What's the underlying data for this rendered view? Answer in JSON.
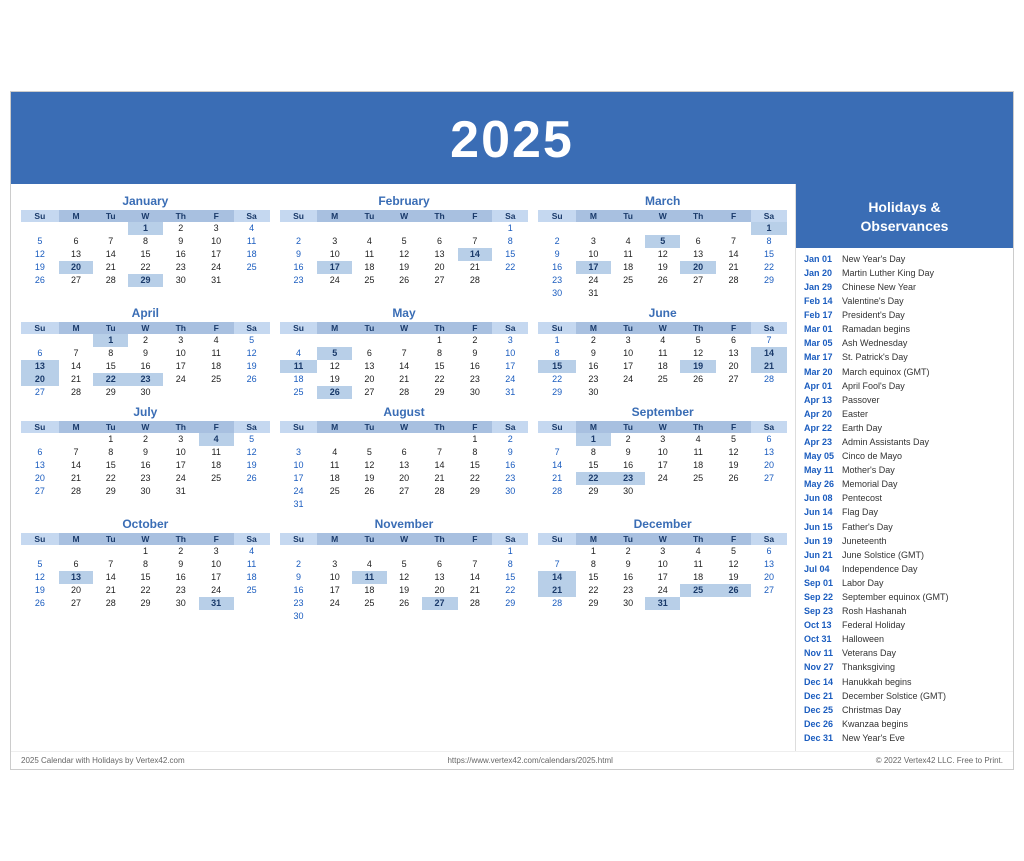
{
  "header": {
    "year": "2025"
  },
  "sidebar_title": "Holidays &\nObservances",
  "holidays": [
    {
      "date": "Jan 01",
      "name": "New Year's Day"
    },
    {
      "date": "Jan 20",
      "name": "Martin Luther King Day"
    },
    {
      "date": "Jan 29",
      "name": "Chinese New Year"
    },
    {
      "date": "Feb 14",
      "name": "Valentine's Day"
    },
    {
      "date": "Feb 17",
      "name": "President's Day"
    },
    {
      "date": "Mar 01",
      "name": "Ramadan begins"
    },
    {
      "date": "Mar 05",
      "name": "Ash Wednesday"
    },
    {
      "date": "Mar 17",
      "name": "St. Patrick's Day"
    },
    {
      "date": "Mar 20",
      "name": "March equinox (GMT)"
    },
    {
      "date": "Apr 01",
      "name": "April Fool's Day"
    },
    {
      "date": "Apr 13",
      "name": "Passover"
    },
    {
      "date": "Apr 20",
      "name": "Easter"
    },
    {
      "date": "Apr 22",
      "name": "Earth Day"
    },
    {
      "date": "Apr 23",
      "name": "Admin Assistants Day"
    },
    {
      "date": "May 05",
      "name": "Cinco de Mayo"
    },
    {
      "date": "May 11",
      "name": "Mother's Day"
    },
    {
      "date": "May 26",
      "name": "Memorial Day"
    },
    {
      "date": "Jun 08",
      "name": "Pentecost"
    },
    {
      "date": "Jun 14",
      "name": "Flag Day"
    },
    {
      "date": "Jun 15",
      "name": "Father's Day"
    },
    {
      "date": "Jun 19",
      "name": "Juneteenth"
    },
    {
      "date": "Jun 21",
      "name": "June Solstice (GMT)"
    },
    {
      "date": "Jul 04",
      "name": "Independence Day"
    },
    {
      "date": "Sep 01",
      "name": "Labor Day"
    },
    {
      "date": "Sep 22",
      "name": "September equinox (GMT)"
    },
    {
      "date": "Sep 23",
      "name": "Rosh Hashanah"
    },
    {
      "date": "Oct 13",
      "name": "Federal Holiday"
    },
    {
      "date": "Oct 31",
      "name": "Halloween"
    },
    {
      "date": "Nov 11",
      "name": "Veterans Day"
    },
    {
      "date": "Nov 27",
      "name": "Thanksgiving"
    },
    {
      "date": "Dec 14",
      "name": "Hanukkah begins"
    },
    {
      "date": "Dec 21",
      "name": "December Solstice (GMT)"
    },
    {
      "date": "Dec 25",
      "name": "Christmas Day"
    },
    {
      "date": "Dec 26",
      "name": "Kwanzaa begins"
    },
    {
      "date": "Dec 31",
      "name": "New Year's Eve"
    }
  ],
  "footer": {
    "left": "2025 Calendar with Holidays by Vertex42.com",
    "center": "https://www.vertex42.com/calendars/2025.html",
    "right": "© 2022 Vertex42 LLC. Free to Print."
  },
  "months": [
    {
      "name": "January",
      "weeks": [
        [
          "",
          "",
          "",
          "1",
          "2",
          "3",
          "4"
        ],
        [
          "5",
          "6",
          "7",
          "8",
          "9",
          "10",
          "11"
        ],
        [
          "12",
          "13",
          "14",
          "15",
          "16",
          "17",
          "18"
        ],
        [
          "19",
          "20",
          "21",
          "22",
          "23",
          "24",
          "25"
        ],
        [
          "26",
          "27",
          "28",
          "29",
          "30",
          "31",
          ""
        ]
      ],
      "holidays": [
        "1"
      ],
      "special": {
        "20": "mlk",
        "29": "cny"
      }
    },
    {
      "name": "February",
      "weeks": [
        [
          "",
          "",
          "",
          "",
          "",
          "",
          "1"
        ],
        [
          "2",
          "3",
          "4",
          "5",
          "6",
          "7",
          "8"
        ],
        [
          "9",
          "10",
          "11",
          "12",
          "13",
          "14",
          "15"
        ],
        [
          "16",
          "17",
          "18",
          "19",
          "20",
          "21",
          "22"
        ],
        [
          "23",
          "24",
          "25",
          "26",
          "27",
          "28",
          ""
        ]
      ],
      "holidays": [
        "14"
      ],
      "special": {
        "17": "pres"
      }
    },
    {
      "name": "March",
      "weeks": [
        [
          "",
          "",
          "",
          "",
          "",
          "",
          "1"
        ],
        [
          "2",
          "3",
          "4",
          "5",
          "6",
          "7",
          "8"
        ],
        [
          "9",
          "10",
          "11",
          "12",
          "13",
          "14",
          "15"
        ],
        [
          "16",
          "17",
          "18",
          "19",
          "20",
          "21",
          "22"
        ],
        [
          "23",
          "24",
          "25",
          "26",
          "27",
          "28",
          "29"
        ],
        [
          "30",
          "31",
          "",
          "",
          "",
          "",
          ""
        ]
      ],
      "holidays": [
        "1"
      ],
      "special": {
        "5": "ash",
        "17": "pat",
        "20": "sol"
      }
    },
    {
      "name": "April",
      "weeks": [
        [
          "",
          "",
          "1",
          "2",
          "3",
          "4",
          "5"
        ],
        [
          "6",
          "7",
          "8",
          "9",
          "10",
          "11",
          "12"
        ],
        [
          "13",
          "14",
          "15",
          "16",
          "17",
          "18",
          "19"
        ],
        [
          "20",
          "21",
          "22",
          "23",
          "24",
          "25",
          "26"
        ],
        [
          "27",
          "28",
          "29",
          "30",
          "",
          "",
          ""
        ]
      ],
      "holidays": [
        "13",
        "20"
      ],
      "special": {
        "1": "afd",
        "22": "earth",
        "23": "aad"
      }
    },
    {
      "name": "May",
      "weeks": [
        [
          "",
          "",
          "",
          "",
          "1",
          "2",
          "3"
        ],
        [
          "4",
          "5",
          "6",
          "7",
          "8",
          "9",
          "10"
        ],
        [
          "11",
          "12",
          "13",
          "14",
          "15",
          "16",
          "17"
        ],
        [
          "18",
          "19",
          "20",
          "21",
          "22",
          "23",
          "24"
        ],
        [
          "25",
          "26",
          "27",
          "28",
          "29",
          "30",
          "31"
        ]
      ],
      "holidays": [
        "11",
        "26"
      ],
      "special": {
        "5": "cinco",
        "26": "mem"
      }
    },
    {
      "name": "June",
      "weeks": [
        [
          "1",
          "2",
          "3",
          "4",
          "5",
          "6",
          "7"
        ],
        [
          "8",
          "9",
          "10",
          "11",
          "12",
          "13",
          "14"
        ],
        [
          "15",
          "16",
          "17",
          "18",
          "19",
          "20",
          "21"
        ],
        [
          "22",
          "23",
          "24",
          "25",
          "26",
          "27",
          "28"
        ],
        [
          "29",
          "30",
          "",
          "",
          "",
          "",
          ""
        ]
      ],
      "holidays": [
        "14",
        "19"
      ],
      "special": {
        "15": "father",
        "21": "sol"
      }
    },
    {
      "name": "July",
      "weeks": [
        [
          "",
          "",
          "1",
          "2",
          "3",
          "4",
          "5"
        ],
        [
          "6",
          "7",
          "8",
          "9",
          "10",
          "11",
          "12"
        ],
        [
          "13",
          "14",
          "15",
          "16",
          "17",
          "18",
          "19"
        ],
        [
          "20",
          "21",
          "22",
          "23",
          "24",
          "25",
          "26"
        ],
        [
          "27",
          "28",
          "29",
          "30",
          "31",
          "",
          ""
        ]
      ],
      "holidays": [
        "4"
      ],
      "special": {}
    },
    {
      "name": "August",
      "weeks": [
        [
          "",
          "",
          "",
          "",
          "",
          "1",
          "2"
        ],
        [
          "3",
          "4",
          "5",
          "6",
          "7",
          "8",
          "9"
        ],
        [
          "10",
          "11",
          "12",
          "13",
          "14",
          "15",
          "16"
        ],
        [
          "17",
          "18",
          "19",
          "20",
          "21",
          "22",
          "23"
        ],
        [
          "24",
          "25",
          "26",
          "27",
          "28",
          "29",
          "30"
        ],
        [
          "31",
          "",
          "",
          "",
          "",
          "",
          ""
        ]
      ],
      "holidays": [],
      "special": {}
    },
    {
      "name": "September",
      "weeks": [
        [
          "",
          "1",
          "2",
          "3",
          "4",
          "5",
          "6"
        ],
        [
          "7",
          "8",
          "9",
          "10",
          "11",
          "12",
          "13"
        ],
        [
          "14",
          "15",
          "16",
          "17",
          "18",
          "19",
          "20"
        ],
        [
          "21",
          "22",
          "23",
          "24",
          "25",
          "26",
          "27"
        ],
        [
          "28",
          "29",
          "30",
          "",
          "",
          "",
          ""
        ]
      ],
      "holidays": [
        "1"
      ],
      "special": {
        "22": "sol",
        "23": "rosh"
      }
    },
    {
      "name": "October",
      "weeks": [
        [
          "",
          "",
          "",
          "1",
          "2",
          "3",
          "4"
        ],
        [
          "5",
          "6",
          "7",
          "8",
          "9",
          "10",
          "11"
        ],
        [
          "12",
          "13",
          "14",
          "15",
          "16",
          "17",
          "18"
        ],
        [
          "19",
          "20",
          "21",
          "22",
          "23",
          "24",
          "25"
        ],
        [
          "26",
          "27",
          "28",
          "29",
          "30",
          "31",
          ""
        ]
      ],
      "holidays": [
        "31"
      ],
      "special": {
        "13": "fed"
      }
    },
    {
      "name": "November",
      "weeks": [
        [
          "",
          "",
          "",
          "",
          "",
          "",
          "1"
        ],
        [
          "2",
          "3",
          "4",
          "5",
          "6",
          "7",
          "8"
        ],
        [
          "9",
          "10",
          "11",
          "12",
          "13",
          "14",
          "15"
        ],
        [
          "16",
          "17",
          "18",
          "19",
          "20",
          "21",
          "22"
        ],
        [
          "23",
          "24",
          "25",
          "26",
          "27",
          "28",
          "29"
        ],
        [
          "30",
          "",
          "",
          "",
          "",
          "",
          ""
        ]
      ],
      "holidays": [
        "11",
        "27"
      ],
      "special": {}
    },
    {
      "name": "December",
      "weeks": [
        [
          "",
          "1",
          "2",
          "3",
          "4",
          "5",
          "6"
        ],
        [
          "7",
          "8",
          "9",
          "10",
          "11",
          "12",
          "13"
        ],
        [
          "14",
          "15",
          "16",
          "17",
          "18",
          "19",
          "20"
        ],
        [
          "21",
          "22",
          "23",
          "24",
          "25",
          "26",
          "27"
        ],
        [
          "28",
          "29",
          "30",
          "31",
          "",
          "",
          ""
        ]
      ],
      "holidays": [
        "25",
        "31"
      ],
      "special": {
        "14": "han",
        "21": "sol",
        "26": "kwz"
      }
    }
  ]
}
